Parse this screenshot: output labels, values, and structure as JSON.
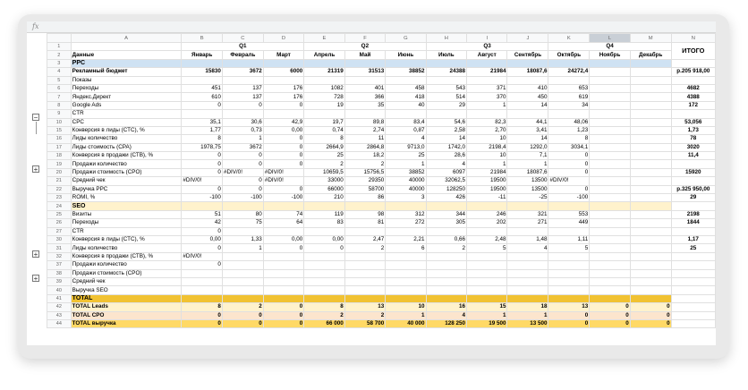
{
  "fx_label": "fx",
  "columns": [
    "A",
    "B",
    "C",
    "D",
    "E",
    "F",
    "G",
    "H",
    "I",
    "J",
    "K",
    "L",
    "M",
    "N"
  ],
  "quarters": [
    "Q1",
    "Q2",
    "Q3",
    "Q4"
  ],
  "header": {
    "label": "Данные",
    "months": [
      "Январь",
      "Февраль",
      "Март",
      "Апрель",
      "Май",
      "Июнь",
      "Июль",
      "Август",
      "Сентябрь",
      "Октябрь",
      "Ноябрь",
      "Декабрь"
    ],
    "total": "ИТОГО"
  },
  "rows": [
    {
      "n": "3",
      "label": "PPC",
      "section": "blue",
      "vals": [
        "",
        "",
        "",
        "",
        "",
        "",
        "",
        "",
        "",
        "",
        "",
        ""
      ],
      "total": ""
    },
    {
      "n": "4",
      "label": "Рекламный бюджет",
      "bold": true,
      "vals": [
        "15830",
        "3672",
        "6000",
        "21319",
        "31513",
        "38852",
        "24388",
        "21984",
        "18087,6",
        "24272,4",
        "",
        ""
      ],
      "total": "р.205 918,00"
    },
    {
      "n": "5",
      "label": "Показы",
      "vals": [
        "",
        "",
        "",
        "",
        "",
        "",
        "",
        "",
        "",
        "",
        "",
        ""
      ],
      "total": ""
    },
    {
      "n": "6",
      "label": "Переходы",
      "vals": [
        "451",
        "137",
        "176",
        "1082",
        "401",
        "458",
        "543",
        "371",
        "410",
        "653",
        "",
        ""
      ],
      "total": "4682"
    },
    {
      "n": "7",
      "label": "Яндекс.Директ",
      "vals": [
        "610",
        "137",
        "176",
        "728",
        "366",
        "418",
        "514",
        "370",
        "450",
        "619",
        "",
        ""
      ],
      "total": "4388"
    },
    {
      "n": "8",
      "label": "Google Ads",
      "vals": [
        "0",
        "0",
        "0",
        "19",
        "35",
        "40",
        "29",
        "1",
        "14",
        "34",
        "",
        ""
      ],
      "total": "172"
    },
    {
      "n": "9",
      "label": "CTR",
      "vals": [
        "",
        "",
        "",
        "",
        "",
        "",
        "",
        "",
        "",
        "",
        "",
        ""
      ],
      "total": ""
    },
    {
      "n": "10",
      "label": "CPC",
      "vals": [
        "35,1",
        "30,6",
        "42,9",
        "19,7",
        "89,8",
        "83,4",
        "54,6",
        "82,3",
        "44,1",
        "48,06",
        "",
        ""
      ],
      "total": "53,056"
    },
    {
      "n": "15",
      "label": "Конверсия в лиды (СТС), %",
      "vals": [
        "1,77",
        "0,73",
        "0,00",
        "0,74",
        "2,74",
        "0,87",
        "2,58",
        "2,70",
        "3,41",
        "1,23",
        "",
        ""
      ],
      "total": "1,73"
    },
    {
      "n": "16",
      "label": "Лиды количество",
      "vals": [
        "8",
        "1",
        "0",
        "8",
        "11",
        "4",
        "14",
        "10",
        "14",
        "8",
        "",
        ""
      ],
      "total": "78"
    },
    {
      "n": "17",
      "label": "Лиды стоимость (CPA)",
      "vals": [
        "1978,75",
        "3672",
        "0",
        "2664,9",
        "2864,8",
        "9713,0",
        "1742,0",
        "2198,4",
        "1292,0",
        "3034,1",
        "",
        ""
      ],
      "total": "3020"
    },
    {
      "n": "18",
      "label": "Конверсия в продажи (СТВ), %",
      "vals": [
        "0",
        "0",
        "0",
        "25",
        "18,2",
        "25",
        "28,6",
        "10",
        "7,1",
        "0",
        "",
        ""
      ],
      "total": "11,4"
    },
    {
      "n": "19",
      "label": "Продажи количество",
      "vals": [
        "0",
        "0",
        "0",
        "2",
        "2",
        "1",
        "4",
        "1",
        "1",
        "0",
        "",
        ""
      ],
      "total": ""
    },
    {
      "n": "20",
      "label": "Продажи стоимость (CPO)",
      "vals": [
        "0",
        "#DIV/0!",
        "#DIV/0!",
        "10659,5",
        "15756,5",
        "38852",
        "6097",
        "21984",
        "18087,6",
        "0",
        "",
        ""
      ],
      "total": "15920"
    },
    {
      "n": "21",
      "label": "Средний чек",
      "vals": [
        "#DIV/0!",
        "0",
        "#DIV/0!",
        "33000",
        "29350",
        "40000",
        "32062,5",
        "19500",
        "13500",
        "#DIV/0!",
        "",
        ""
      ],
      "total": ""
    },
    {
      "n": "22",
      "label": "Выручка PPC",
      "vals": [
        "0",
        "0",
        "0",
        "66000",
        "58700",
        "40000",
        "128250",
        "19500",
        "13500",
        "0",
        "",
        ""
      ],
      "total": "р.325 950,00"
    },
    {
      "n": "23",
      "label": "ROMI, %",
      "vals": [
        "-100",
        "-100",
        "-100",
        "210",
        "86",
        "3",
        "426",
        "-11",
        "-25",
        "-100",
        "",
        ""
      ],
      "total": "29"
    },
    {
      "n": "24",
      "label": "SEO",
      "section": "yellow",
      "vals": [
        "",
        "",
        "",
        "",
        "",
        "",
        "",
        "",
        "",
        "",
        "",
        ""
      ],
      "total": ""
    },
    {
      "n": "25",
      "label": "Визиты",
      "vals": [
        "51",
        "80",
        "74",
        "119",
        "98",
        "312",
        "344",
        "246",
        "321",
        "553",
        "",
        ""
      ],
      "total": "2198"
    },
    {
      "n": "26",
      "label": "Переходы",
      "vals": [
        "42",
        "75",
        "64",
        "83",
        "81",
        "272",
        "305",
        "202",
        "271",
        "449",
        "",
        ""
      ],
      "total": "1844"
    },
    {
      "n": "27",
      "label": "CTR",
      "vals": [
        "0",
        "",
        "",
        "",
        "",
        "",
        "",
        "",
        "",
        "",
        "",
        ""
      ],
      "total": ""
    },
    {
      "n": "30",
      "label": "Конверсия в лиды (СТС), %",
      "vals": [
        "0,00",
        "1,33",
        "0,00",
        "0,00",
        "2,47",
        "2,21",
        "0,66",
        "2,48",
        "1,48",
        "1,11",
        "",
        ""
      ],
      "total": "1,17"
    },
    {
      "n": "31",
      "label": "Лиды количество",
      "vals": [
        "0",
        "1",
        "0",
        "0",
        "2",
        "6",
        "2",
        "5",
        "4",
        "5",
        "",
        ""
      ],
      "total": "25"
    },
    {
      "n": "32",
      "label": "Конверсия в продажи (СТВ), %",
      "vals": [
        "#DIV/0!",
        "",
        "",
        "",
        "",
        "",
        "",
        "",
        "",
        "",
        "",
        ""
      ],
      "total": ""
    },
    {
      "n": "37",
      "label": "Продажи количество",
      "vals": [
        "0",
        "",
        "",
        "",
        "",
        "",
        "",
        "",
        "",
        "",
        "",
        ""
      ],
      "total": ""
    },
    {
      "n": "38",
      "label": "Продажи стоимость (CPO)",
      "vals": [
        "",
        "",
        "",
        "",
        "",
        "",
        "",
        "",
        "",
        "",
        "",
        ""
      ],
      "total": ""
    },
    {
      "n": "39",
      "label": "Средний чек",
      "vals": [
        "",
        "",
        "",
        "",
        "",
        "",
        "",
        "",
        "",
        "",
        "",
        ""
      ],
      "total": ""
    },
    {
      "n": "40",
      "label": "Выручка SEO",
      "vals": [
        "",
        "",
        "",
        "",
        "",
        "",
        "",
        "",
        "",
        "",
        "",
        ""
      ],
      "total": ""
    },
    {
      "n": "41",
      "label": "TOTAL",
      "section": "gold",
      "vals": [
        "",
        "",
        "",
        "",
        "",
        "",
        "",
        "",
        "",
        "",
        "",
        ""
      ],
      "total": ""
    },
    {
      "n": "42",
      "label": "TOTAL Leads",
      "style": "leads",
      "vals": [
        "8",
        "2",
        "0",
        "8",
        "13",
        "10",
        "16",
        "15",
        "18",
        "13",
        "0",
        "0"
      ],
      "total": ""
    },
    {
      "n": "43",
      "label": "TOTAL CPO",
      "style": "cpo",
      "vals": [
        "0",
        "0",
        "0",
        "2",
        "2",
        "1",
        "4",
        "1",
        "1",
        "0",
        "0",
        "0"
      ],
      "total": ""
    },
    {
      "n": "44",
      "label": "TOTAL выручка",
      "style": "rev",
      "vals": [
        "0",
        "0",
        "0",
        "66 000",
        "58 700",
        "40 000",
        "128 250",
        "19 500",
        "13 500",
        "0",
        "0",
        "0"
      ],
      "total": ""
    }
  ]
}
